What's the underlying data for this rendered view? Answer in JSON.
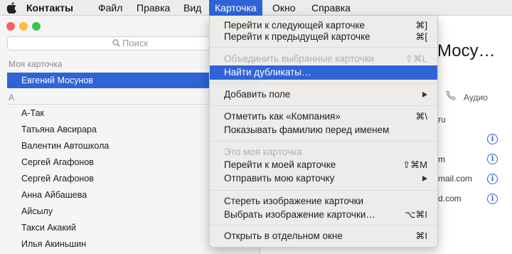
{
  "menubar": {
    "app": "Контакты",
    "items": [
      "Файл",
      "Правка",
      "Вид",
      "Карточка",
      "Окно",
      "Справка"
    ]
  },
  "sidebar": {
    "search_placeholder": "Поиск",
    "my_card_header": "Моя карточка",
    "my_card": "Евгений Мосунов",
    "section_letter": "А",
    "contacts": [
      "А-Так",
      "Татьяна Авсирара",
      "Валентин Автошкола",
      "Сергей Агафонов",
      "Сергей Агафонов",
      "Анна Айбашева",
      "Айсылу",
      "Такси Акакий",
      "Илья Акиньшин"
    ]
  },
  "detail": {
    "name": "Мосу…",
    "audio_label": "Аудио",
    "fragments": [
      "ru",
      "m",
      "mail.com",
      "d.com"
    ]
  },
  "card_menu": {
    "next": {
      "label": "Перейти к следующей карточке",
      "shortcut": "⌘]"
    },
    "prev": {
      "label": "Перейти к предыдущей карточке",
      "shortcut": "⌘["
    },
    "merge": {
      "label": "Объединить выбранные карточки",
      "shortcut": "⇧⌘L"
    },
    "duplicates": {
      "label": "Найти дубликаты…"
    },
    "add_field": {
      "label": "Добавить поле"
    },
    "company": {
      "label": "Отметить как «Компания»",
      "shortcut": "⌘\\"
    },
    "surname_first": {
      "label": "Показывать фамилию перед именем"
    },
    "my_card": {
      "label": "Это моя карточка"
    },
    "go_my_card": {
      "label": "Перейти к моей карточке",
      "shortcut": "⇧⌘M"
    },
    "send_my_card": {
      "label": "Отправить мою карточку"
    },
    "clear_image": {
      "label": "Стереть изображение карточки"
    },
    "choose_image": {
      "label": "Выбрать изображение карточки…",
      "shortcut": "⌥⌘I"
    },
    "open_window": {
      "label": "Открыть в отдельном окне",
      "shortcut": "⌘I"
    }
  },
  "colors": {
    "accent": "#2f63d6",
    "close": "#fc605c",
    "minimize": "#fdbc40",
    "zoom": "#34c84a"
  }
}
